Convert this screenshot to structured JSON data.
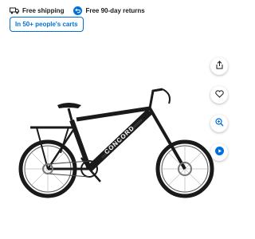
{
  "perks": [
    {
      "icon": "delivery-truck-icon",
      "label": "Free shipping"
    },
    {
      "icon": "return-arrow-icon",
      "label": "Free 90-day returns"
    }
  ],
  "cart_badge": "In 50+ people's carts",
  "product_image": {
    "brand_text": "CONCORD",
    "frame_color": "#1a1a1a",
    "accent": "#0071dc"
  },
  "actions": [
    {
      "icon": "share-icon"
    },
    {
      "icon": "heart-icon"
    },
    {
      "icon": "zoom-in-icon"
    },
    {
      "icon": "play-icon"
    }
  ]
}
